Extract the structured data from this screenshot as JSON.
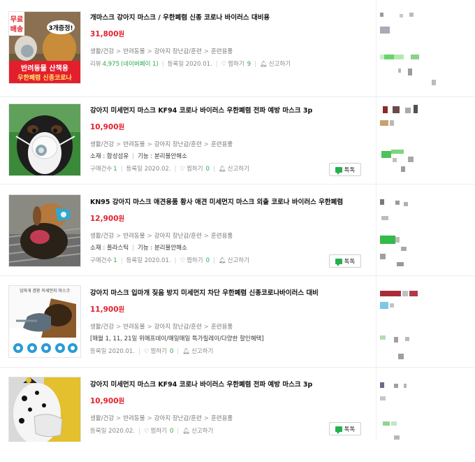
{
  "products": [
    {
      "title": "개마스크 강아지 마스크 / 우한폐렴 신종 코로나 바이러스 대비용",
      "price": "31,800",
      "won": "원",
      "category": [
        "생활/건강",
        "반려동물",
        "강아지 장난감/훈련",
        "훈련용품"
      ],
      "spec": null,
      "meta": {
        "review_label": "리뷰",
        "review_count": "4,975",
        "review_source": "(네이버페이 1)",
        "date": "등록일 2020.01.",
        "wish_label": "찜하기",
        "wish_count": "9",
        "report_label": "신고하기"
      },
      "talk": null,
      "image_text": {
        "badge": "무료배송",
        "top": "3개증정!",
        "line1": "반려동물 산책용",
        "line2": "우한폐렴 신종코로나"
      }
    },
    {
      "title": "강아지 미세먼지 마스크 KF94 코로나 바이러스 우한폐렴 전파 예방 마스크 3p",
      "price": "10,900",
      "won": "원",
      "category": [
        "생활/건강",
        "반려동물",
        "강아지 장난감/훈련",
        "훈련용품"
      ],
      "spec": {
        "material": "소재 : 합성섬유",
        "function": "기능 : 분리불안해소"
      },
      "meta": {
        "purchase_label": "구매건수",
        "purchase_count": "1",
        "date": "등록일 2020.02.",
        "wish_label": "찜하기",
        "wish_count": "0",
        "report_label": "신고하기"
      },
      "talk": "톡톡"
    },
    {
      "title": "KN95 강아지 마스크 애견용품 황사 애견 미세먼지 마스크 외출 코로나 바이러스 우한폐렴",
      "price": "12,900",
      "won": "원",
      "category": [
        "생활/건강",
        "반려동물",
        "강아지 장난감/훈련",
        "훈련용품"
      ],
      "spec": {
        "material": "소재 : 플라스틱",
        "function": "기능 : 분리불안해소"
      },
      "meta": {
        "purchase_label": "구매건수",
        "purchase_count": "1",
        "date": "등록일 2020.01.",
        "wish_label": "찜하기",
        "wish_count": "0",
        "report_label": "신고하기"
      },
      "talk": "톡톡"
    },
    {
      "title": "강아지 마스크 입마개 짖음 방지 미세먼지 차단 우한폐렴 신종코로나바이러스 대비",
      "price": "11,900",
      "won": "원",
      "category": [
        "생활/건강",
        "반려동물",
        "강아지 장난감/훈련",
        "훈련용품"
      ],
      "promo": "[매월 1, 11, 21일 위메프데이/매일매일 특가릴레이/다양한 할인혜택]",
      "meta": {
        "date": "등록일 2020.01.",
        "wish_label": "찜하기",
        "wish_count": "0",
        "report_label": "신고하기"
      },
      "talk": null,
      "image_text": {
        "caption": "입마개 겸용 미세먼지 마스크"
      }
    },
    {
      "title": "강아지 미세먼지 마스크 KF94 코로나 바이러스 우한폐렴 전파 예방 마스크 3p",
      "price": "10,900",
      "won": "원",
      "category": [
        "생활/건강",
        "반려동물",
        "강아지 장난감/훈련",
        "훈련용품"
      ],
      "meta": {
        "date": "등록일 2020.02.",
        "wish_label": "찜하기",
        "wish_count": "0",
        "report_label": "신고하기"
      },
      "talk": "톡톡"
    }
  ],
  "colors": {
    "price": "#e2222d",
    "count": "#2aa844",
    "talk_icon": "#23b14d"
  }
}
